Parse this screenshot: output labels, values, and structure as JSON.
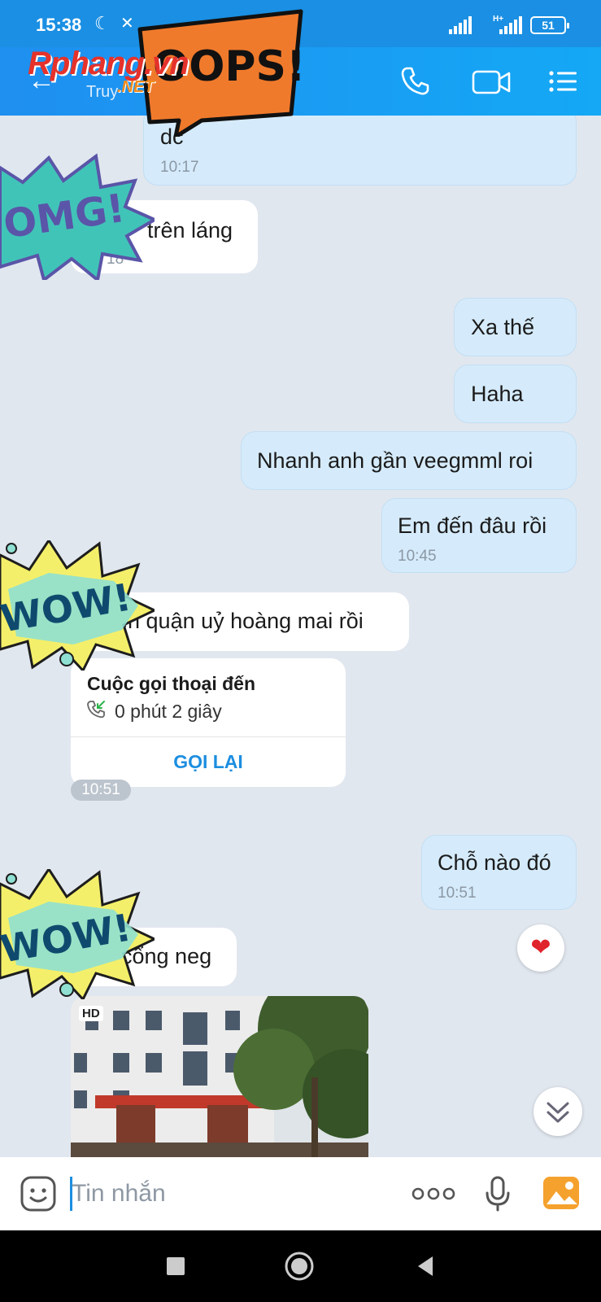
{
  "status_bar": {
    "time": "15:38",
    "network": "H+",
    "battery": "51"
  },
  "header": {
    "contact_status": "Truy",
    "icons": [
      "back-arrow-icon",
      "phone-icon",
      "video-call-icon",
      "menu-list-icon"
    ]
  },
  "watermark": {
    "brand": "Rphang.vn",
    "brand_suffix": ".NET"
  },
  "stickers": {
    "oops": "OOPS!",
    "omg": "OMG!",
    "wow": "WOW!"
  },
  "messages": [
    {
      "id": "m1",
      "side": "out",
      "text": "dc",
      "time": "10:17"
    },
    {
      "id": "m2",
      "side": "in",
      "text": "trên láng",
      "time": "18"
    },
    {
      "id": "m3",
      "side": "out",
      "text": "Xa thế"
    },
    {
      "id": "m4",
      "side": "out",
      "text": "Haha"
    },
    {
      "id": "m5",
      "side": "out",
      "text": "Nhanh anh gần veegmml roi"
    },
    {
      "id": "m6",
      "side": "out",
      "text": "Em đến đâu rồi",
      "time": "10:45"
    },
    {
      "id": "m7",
      "side": "in",
      "text": "ến quận uỷ hoàng mai rồi"
    },
    {
      "id": "m8",
      "side": "out",
      "text": "Chỗ nào đó",
      "time": "10:51"
    },
    {
      "id": "m9",
      "side": "in",
      "text": "cổng neg"
    }
  ],
  "call_card": {
    "title": "Cuộc gọi thoại đến",
    "duration": "0 phút 2 giây",
    "callback_label": "GỌI LẠI",
    "time": "10:51"
  },
  "reaction": {
    "emoji": "❤"
  },
  "photo": {
    "badge": "HD"
  },
  "composer": {
    "placeholder": "Tin nhắn"
  },
  "colors": {
    "header": "#1a8fe3",
    "outgoing_bubble": "#d5ebfb",
    "incoming_bubble": "#ffffff",
    "chat_background": "#e1e7ef",
    "accent": "#1c8ee0"
  }
}
